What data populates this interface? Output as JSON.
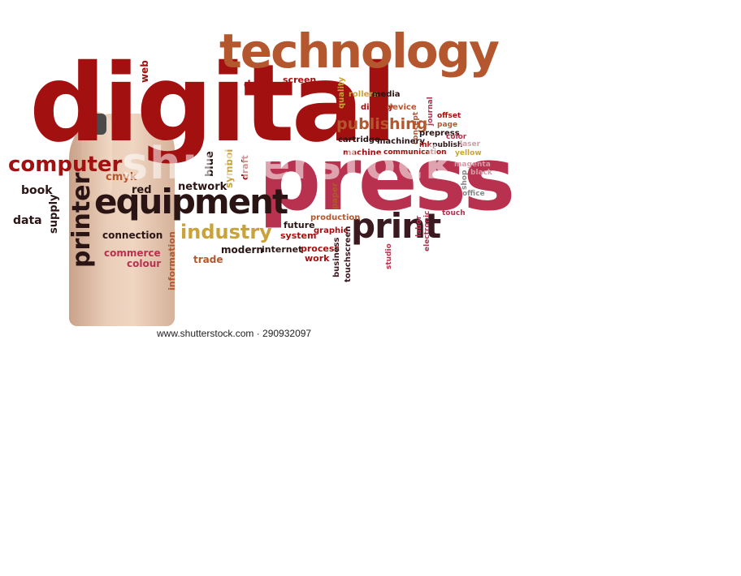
{
  "cloud": {
    "digital": "digital",
    "technology": "technology",
    "press": "press",
    "equipment": "equipment",
    "computer": "computer",
    "print": "print",
    "printer": "printer",
    "industry": "industry",
    "publishing": "publishing",
    "web": "web",
    "design": "design",
    "screen": "screen",
    "quality": "quality",
    "rollers": "rollers",
    "media": "media",
    "display": "display",
    "device": "device",
    "journal": "journal",
    "offset": "offset",
    "page": "page",
    "concept": "concept",
    "prepress": "prepress",
    "color": "color",
    "cartridge": "cartridge",
    "machinery": "machinery",
    "ink": "ink",
    "publish": "publish",
    "laser": "laser",
    "machine": "machine",
    "communication": "communication",
    "yellow": "yellow",
    "magenta": "magenta",
    "black": "black",
    "shop": "shop",
    "office": "office",
    "touch": "touch",
    "blue": "blue",
    "symbol": "symbol",
    "draft": "draft",
    "cmyk": "cmyk",
    "book": "book",
    "red": "red",
    "network": "network",
    "data": "data",
    "supply": "supply",
    "connection": "connection",
    "commerce": "commerce",
    "colour": "colour",
    "information": "information",
    "trade": "trade",
    "modern": "modern",
    "internet": "internet",
    "future": "future",
    "system": "system",
    "graphic": "graphic",
    "production": "production",
    "paper": "paper",
    "process": "process",
    "work": "work",
    "business": "business",
    "touchscreen": "touchscreen",
    "studio": "studio",
    "labor": "labor",
    "electronic": "electronic"
  },
  "watermark": "shutterstock",
  "stock_caption": "www.shutterstock.com · 290932097"
}
